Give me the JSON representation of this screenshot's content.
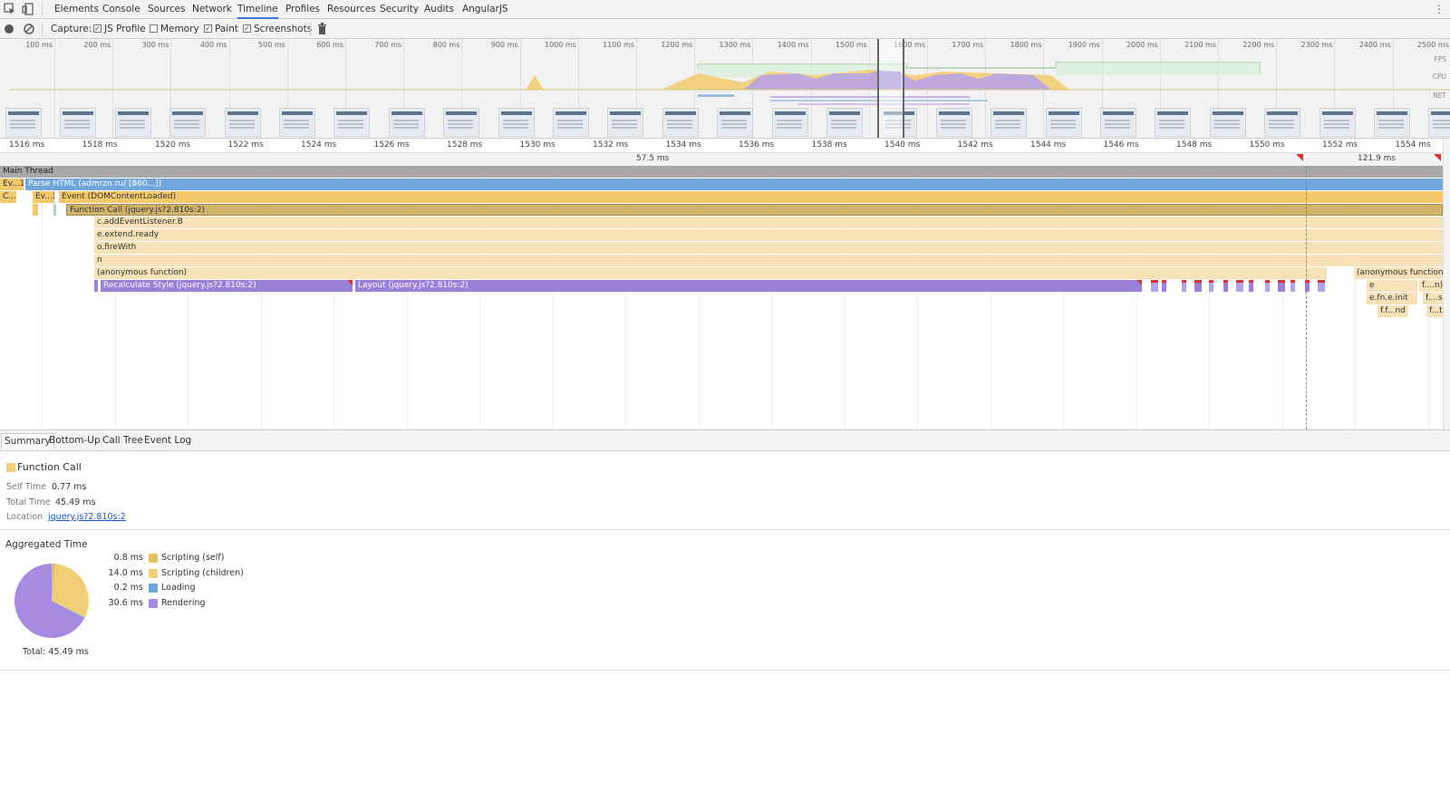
{
  "tabs": [
    "Elements",
    "Console",
    "Sources",
    "Network",
    "Timeline",
    "Profiles",
    "Resources",
    "Security",
    "Audits",
    "AngularJS"
  ],
  "toolbar": {
    "capture_label": "Capture:",
    "js_profile": "JS Profile",
    "memory": "Memory",
    "paint": "Paint",
    "screenshots": "Screenshots"
  },
  "overview": {
    "ticks": [
      "100 ms",
      "200 ms",
      "300 ms",
      "400 ms",
      "500 ms",
      "600 ms",
      "700 ms",
      "800 ms",
      "900 ms",
      "1000 ms",
      "1100 ms",
      "1200 ms",
      "1300 ms",
      "1400 ms",
      "1500 ms",
      "1600 ms",
      "1700 ms",
      "1800 ms",
      "1900 ms",
      "2000 ms",
      "2100 ms",
      "2200 ms",
      "2300 ms",
      "2400 ms",
      "2500 ms"
    ],
    "lanes": [
      "FPS",
      "CPU",
      "NET"
    ]
  },
  "ruler": {
    "ticks": [
      "1516 ms",
      "1518 ms",
      "1520 ms",
      "1522 ms",
      "1524 ms",
      "1526 ms",
      "1528 ms",
      "1530 ms",
      "1532 ms",
      "1534 ms",
      "1536 ms",
      "1538 ms",
      "1540 ms",
      "1542 ms",
      "1544 ms",
      "1546 ms",
      "1548 ms",
      "1550 ms",
      "1552 ms",
      "1554 ms"
    ],
    "marker1": "57.5 ms",
    "marker2": "121.9 ms"
  },
  "flame": {
    "main_thread": "Main Thread",
    "ev1": "Ev...1)",
    "parse_html": "Parse HTML (admrzn.ru/ [860...])",
    "c_short": "C...)",
    "ev_short": "Ev...)",
    "event_dom": "Event (DOMContentLoaded)",
    "function_call": "Function Call (jquery.js?2.810s:2)",
    "add_event": "c.addEventListener.B",
    "extend_ready": "e.extend.ready",
    "fire_with": "o.fireWith",
    "n": "n",
    "anon": "(anonymous function)",
    "recalc": "Recalculate Style (jquery.js?2.810s:2)",
    "layout": "Layout (jquery.js?2.810s:2)",
    "anon2": "(anonymous function)",
    "e": "e",
    "fn_init": "e.fn.e.init",
    "ffn": "f....n)",
    "ffs": "f....s",
    "ffnd": "f.f...nd",
    "fft": "f...t"
  },
  "detail_tabs": [
    "Summary",
    "Bottom-Up",
    "Call Tree",
    "Event Log"
  ],
  "summary": {
    "title": "Function Call",
    "self_time_label": "Self Time",
    "self_time": "0.77 ms",
    "total_time_label": "Total Time",
    "total_time": "45.49 ms",
    "location_label": "Location",
    "location": "jquery.js?2.810s:2",
    "aggregated_title": "Aggregated Time",
    "legend": [
      {
        "value": "0.8 ms",
        "label": "Scripting (self)",
        "color": "#e5c15b"
      },
      {
        "value": "14.0 ms",
        "label": "Scripting (children)",
        "color": "#f0cf76"
      },
      {
        "value": "0.2 ms",
        "label": "Loading",
        "color": "#6fa8dc"
      },
      {
        "value": "30.6 ms",
        "label": "Rendering",
        "color": "#a78be0"
      }
    ],
    "total": "Total: 45.49 ms"
  },
  "chart_data": {
    "type": "pie",
    "categories": [
      "Scripting (self)",
      "Scripting (children)",
      "Loading",
      "Rendering"
    ],
    "values": [
      0.8,
      14.0,
      0.2,
      30.6
    ],
    "colors": [
      "#e5c15b",
      "#f0cf76",
      "#6fa8dc",
      "#a78be0"
    ]
  }
}
